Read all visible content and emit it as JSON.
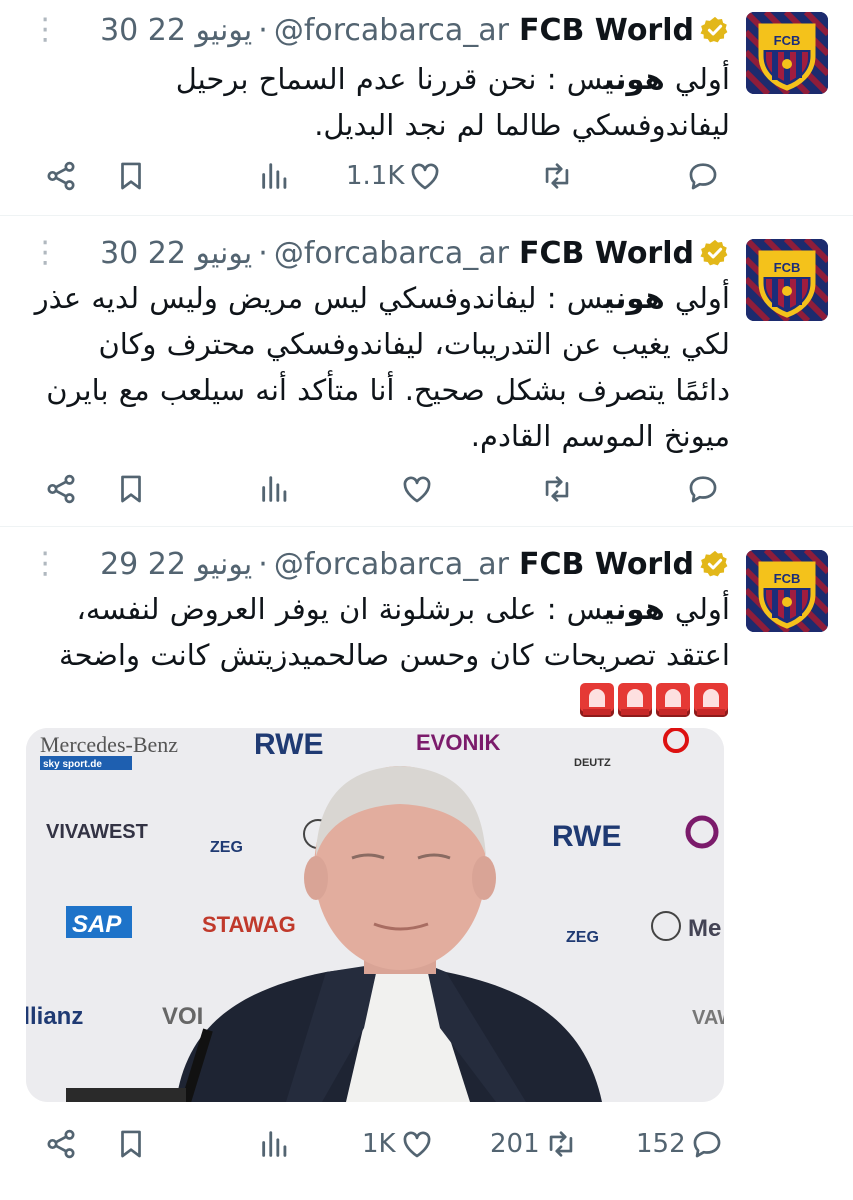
{
  "account": {
    "display_name": "FCB World",
    "handle": "@forcabarca_ar",
    "avatar_text": "FCB"
  },
  "tweets": [
    {
      "date": "30 يونيو 22",
      "text_prefix": "أولي ",
      "text_bold": "هوني",
      "text_rest": "س : نحن قررنا عدم السماح برحيل ليفاندوفسكي طالما لم نجد البديل.",
      "counts": {
        "like": "1.1K",
        "retweet": "",
        "reply": ""
      }
    },
    {
      "date": "30 يونيو 22",
      "text_prefix": "أولي ",
      "text_bold": "هوني",
      "text_rest": "س : ليفاندوفسكي ليس مريض وليس لديه عذر لكي يغيب عن التدريبات، ليفاندوفسكي محترف وكان دائمًا يتصرف بشكل صحيح. أنا متأكد أنه سيلعب مع بايرن ميونخ الموسم القادم.",
      "counts": {
        "like": "",
        "retweet": "",
        "reply": ""
      }
    },
    {
      "date": "29 يونيو 22",
      "text_prefix": "أولي ",
      "text_bold": "هوني",
      "text_rest": "س : على برشلونة ان يوفر العروض لنفسه، اعتقد تصريحات كان وحسن صالحميدزيتش كانت واضحة",
      "counts": {
        "like": "1K",
        "retweet": "201",
        "reply": "152"
      },
      "media": {
        "sponsors": [
          "Mercedes-Benz",
          "RWE",
          "EVONIK",
          "VIVAWEST",
          "SAP",
          "STAWAG",
          "Allianz",
          "DEUTZ",
          "ZEG",
          "sky sport.de",
          "Me",
          "VOI",
          "VAW"
        ]
      }
    }
  ],
  "icons": [
    "more-icon",
    "verified-icon",
    "share-icon",
    "bookmark-icon",
    "views-icon",
    "like-icon",
    "retweet-icon",
    "reply-icon",
    "siren-emoji"
  ],
  "colors": {
    "text": "#0f1419",
    "secondary": "#536471",
    "verified": "#e2b719",
    "siren": "#e53935",
    "divider": "#eff3f4"
  }
}
